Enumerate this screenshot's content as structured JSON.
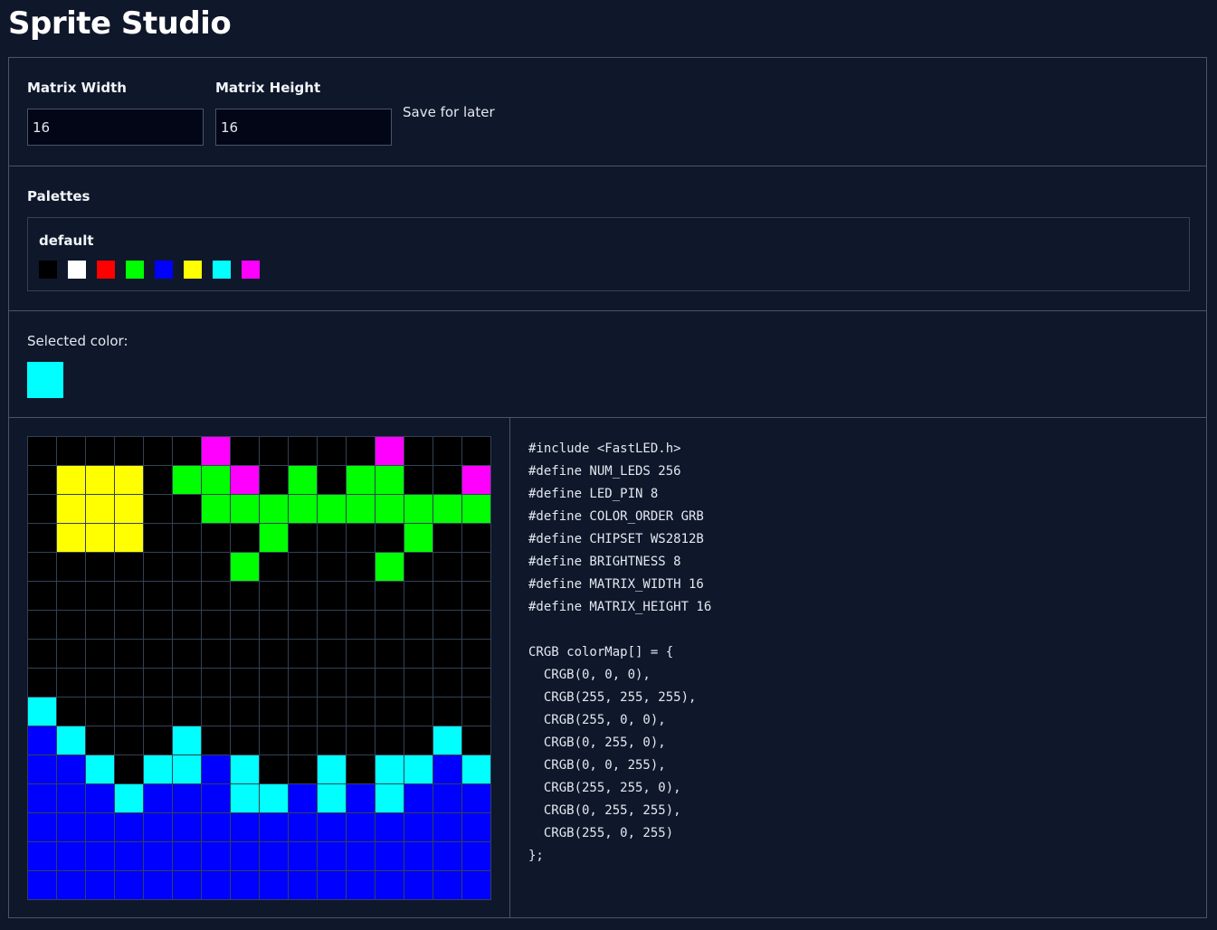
{
  "app": {
    "title": "Sprite Studio"
  },
  "dimensions": {
    "width_label": "Matrix Width",
    "width_value": "16",
    "height_label": "Matrix Height",
    "height_value": "16",
    "save_label": "Save for later"
  },
  "palettes": {
    "title": "Palettes",
    "items": [
      {
        "name": "default",
        "colors": [
          "#000000",
          "#ffffff",
          "#ff0000",
          "#00ff00",
          "#0000ff",
          "#ffff00",
          "#00ffff",
          "#ff00ff"
        ]
      }
    ]
  },
  "selected": {
    "label": "Selected color:",
    "color": "#00ffff"
  },
  "matrix": {
    "grid_color": "#334155",
    "rows": [
      "0000007000007000",
      "0555033703033007",
      "0555003333333333",
      "0555000030000300",
      "0000000300003000",
      "0000000000000000",
      "0000000000000000",
      "0000000000000000",
      "0000000000000000",
      "6000000000000000",
      "4600060000000060",
      "4460664600606646",
      "4446444664646444",
      "4444444444444444",
      "4444444444444444",
      "4444444444444444"
    ]
  },
  "code": {
    "lines": [
      "#include <FastLED.h>",
      "#define NUM_LEDS 256",
      "#define LED_PIN 8",
      "#define COLOR_ORDER GRB",
      "#define CHIPSET WS2812B",
      "#define BRIGHTNESS 8",
      "#define MATRIX_WIDTH 16",
      "#define MATRIX_HEIGHT 16",
      "",
      "CRGB colorMap[] = {",
      "  CRGB(0, 0, 0),",
      "  CRGB(255, 255, 255),",
      "  CRGB(255, 0, 0),",
      "  CRGB(0, 255, 0),",
      "  CRGB(0, 0, 255),",
      "  CRGB(255, 255, 0),",
      "  CRGB(0, 255, 255),",
      "  CRGB(255, 0, 255)",
      "};"
    ]
  }
}
